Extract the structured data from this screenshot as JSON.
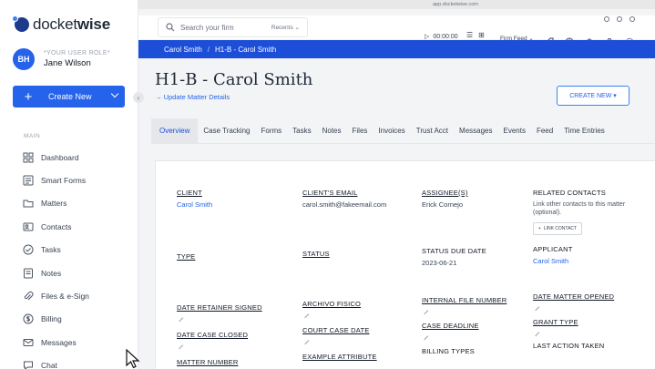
{
  "brand": {
    "logo_text_light": "docket",
    "logo_text_bold": "wise"
  },
  "user": {
    "initials": "BH",
    "role": "*YOUR USER ROLE*",
    "name": "Jane Wilson"
  },
  "sidebar": {
    "create_new_label": "Create New",
    "section_label": "MAIN",
    "items": [
      {
        "label": "Dashboard",
        "icon": "grid-icon"
      },
      {
        "label": "Smart Forms",
        "icon": "forms-icon"
      },
      {
        "label": "Matters",
        "icon": "folder-icon"
      },
      {
        "label": "Contacts",
        "icon": "person-card-icon"
      },
      {
        "label": "Tasks",
        "icon": "check-circle-icon"
      },
      {
        "label": "Notes",
        "icon": "note-icon"
      },
      {
        "label": "Files & e-Sign",
        "icon": "paperclip-icon"
      },
      {
        "label": "Billing",
        "icon": "dollar-icon"
      },
      {
        "label": "Messages",
        "icon": "envelope-icon"
      },
      {
        "label": "Chat",
        "icon": "chat-icon"
      }
    ]
  },
  "browser": {
    "url": "app.docketwise.com"
  },
  "toolbar": {
    "search_placeholder": "Search your firm",
    "recents_label": "Recents",
    "timer": "00:00:00",
    "firm_feed_label": "Firm Feed"
  },
  "breadcrumb": {
    "parent": "Carol Smith",
    "current": "H1-B - Carol Smith"
  },
  "matter": {
    "title": "H1-B - Carol Smith",
    "update_link": "→ Update Matter Details",
    "create_new_button": "CREATE NEW"
  },
  "tabs": [
    "Overview",
    "Case Tracking",
    "Forms",
    "Tasks",
    "Notes",
    "Files",
    "Invoices",
    "Trust Acct",
    "Messages",
    "Events",
    "Feed",
    "Time Entries"
  ],
  "details": {
    "client_label": "CLIENT",
    "client_value": "Carol Smith",
    "email_label": "CLIENT'S EMAIL",
    "email_value": "carol.smith@fakeemail.com",
    "assignees_label": "ASSIGNEE(S)",
    "assignees_value": "Erick Cornejo",
    "related_label": "RELATED CONTACTS",
    "related_help": "Link other contacts to this matter (optional).",
    "link_contact_button": "LINK CONTACT",
    "type_label": "TYPE",
    "status_label": "STATUS",
    "status_due_label": "STATUS DUE DATE",
    "status_due_value": "2023-06-21",
    "applicant_label": "APPLICANT",
    "applicant_value": "Carol Smith",
    "retainer_label": "DATE RETAINER SIGNED",
    "archivo_label": "ARCHIVO FISICO",
    "internal_label": "INTERNAL FILE NUMBER",
    "opened_label": "DATE MATTER OPENED",
    "closed_label": "DATE CASE CLOSED",
    "court_label": "COURT CASE DATE",
    "deadline_label": "CASE DEADLINE",
    "grant_label": "GRANT TYPE",
    "matter_number_label": "MATTER NUMBER",
    "example_label": "EXAMPLE ATTRIBUTE",
    "billing_label": "BILLING TYPES",
    "last_action_label": "LAST ACTION TAKEN"
  }
}
